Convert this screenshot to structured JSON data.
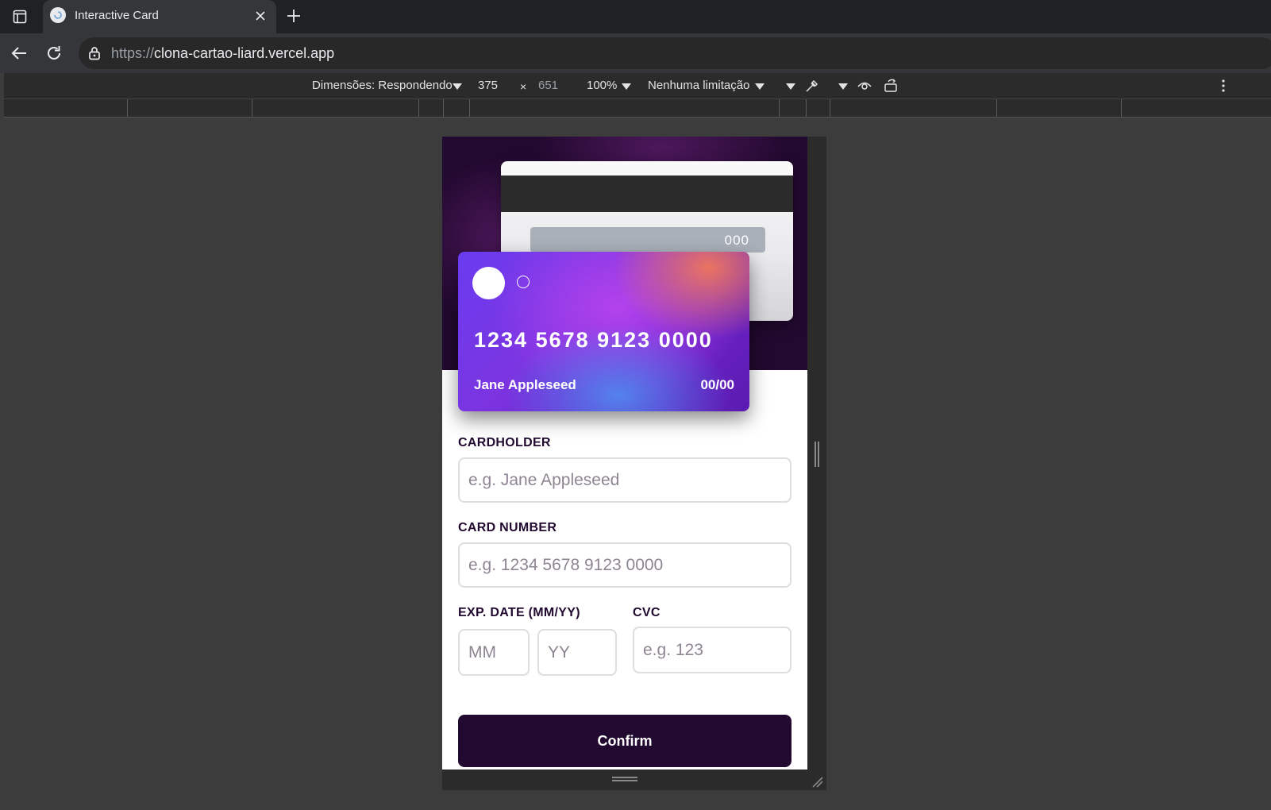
{
  "browser": {
    "tab": {
      "title": "Interactive Card"
    },
    "url": {
      "scheme": "https://",
      "host": "clona-cartao-liard.vercel.app"
    }
  },
  "devtools": {
    "dimensions_label": "Dimensões: Respondendo",
    "width": "375",
    "times": "×",
    "height": "651",
    "zoom": "100%",
    "throttle": "Nenhuma limitação"
  },
  "card_back": {
    "cvc": "000"
  },
  "card_front": {
    "number": "1234 5678 9123 0000",
    "holder": "Jane Appleseed",
    "expiry": "00/00"
  },
  "form": {
    "cardholder": {
      "label": "CARDHOLDER",
      "placeholder": "e.g. Jane Appleseed"
    },
    "card_number": {
      "label": "CARD NUMBER",
      "placeholder": "e.g. 1234 5678 9123 0000"
    },
    "exp_date": {
      "label": "EXP. DATE (MM/YY)",
      "month_placeholder": "MM",
      "year_placeholder": "YY"
    },
    "cvc": {
      "label": "CVC",
      "placeholder": "e.g. 123"
    },
    "confirm_label": "Confirm"
  },
  "colors": {
    "dark_violet": "#21092f",
    "input_border": "#dedddf",
    "placeholder": "#8e8593"
  }
}
